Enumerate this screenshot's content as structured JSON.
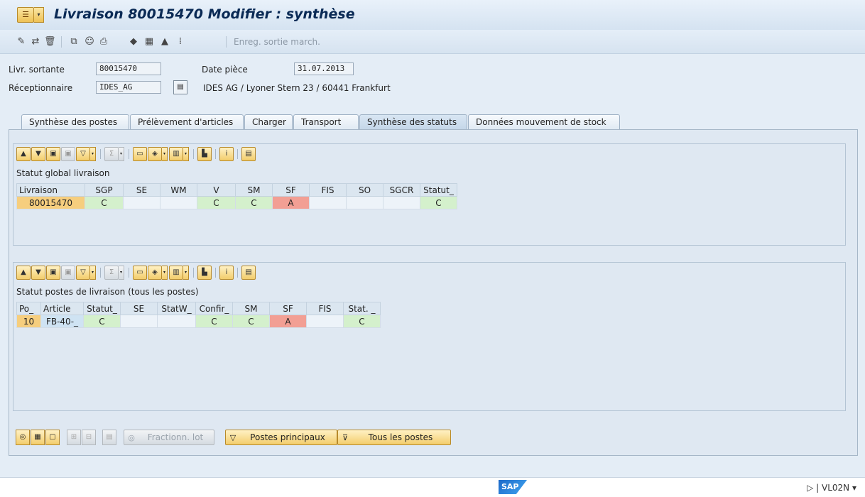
{
  "window": {
    "title": "Livraison 80015470 Modifier : synthèse"
  },
  "toolbar": {
    "icons": [
      "edit-icon",
      "display-change-icon",
      "delete-icon",
      "copy-icon",
      "partner-icon",
      "print-icon",
      "picking-icon",
      "header-icon",
      "goods-issue-icon",
      "extras-icon"
    ],
    "post_gi_label": "Enreg. sortie march."
  },
  "header": {
    "delivery_label": "Livr. sortante",
    "delivery_value": "80015470",
    "date_label": "Date pièce",
    "date_value": "31.07.2013",
    "recipient_label": "Réceptionnaire",
    "recipient_value": "IDES_AG",
    "recipient_address": "IDES AG / Lyoner Stern 23 / 60441 Frankfurt"
  },
  "tabs": [
    {
      "label": "Synthèse des postes"
    },
    {
      "label": "Prélèvement d'articles"
    },
    {
      "label": "Charger"
    },
    {
      "label": "Transport"
    },
    {
      "label": "Synthèse des statuts"
    },
    {
      "label": "Données mouvement de stock"
    }
  ],
  "active_tab": "Synthèse des statuts",
  "global_status": {
    "title": "Statut global livraison",
    "columns": [
      "Livraison",
      "SGP",
      "SE",
      "WM",
      "V",
      "SM",
      "SF",
      "FIS",
      "SO",
      "SGCR",
      "Statut_"
    ],
    "rows": [
      [
        "80015470",
        "C",
        "",
        "",
        "C",
        "C",
        "A",
        "",
        "",
        "",
        "C"
      ]
    ]
  },
  "item_status": {
    "title": "Statut postes de livraison (tous les postes)",
    "columns": [
      "Po_",
      "Article",
      "Statut_",
      "SE",
      "StatW_",
      "Confir_",
      "SM",
      "SF",
      "FIS",
      "Stat. _"
    ],
    "rows": [
      [
        "10",
        "FB-40-_",
        "C",
        "",
        "",
        "C",
        "C",
        "A",
        "",
        "C"
      ]
    ]
  },
  "bottom_buttons": {
    "split_batch": "Fractionn. lot",
    "main_items": "Postes principaux",
    "all_items": "Tous les postes"
  },
  "statusbar": {
    "logo": "SAP",
    "transaction": "VL02N"
  },
  "colors": {
    "status_green": "#d4f0cc",
    "status_red": "#f29f94",
    "key_orange": "#f6ce7e"
  }
}
